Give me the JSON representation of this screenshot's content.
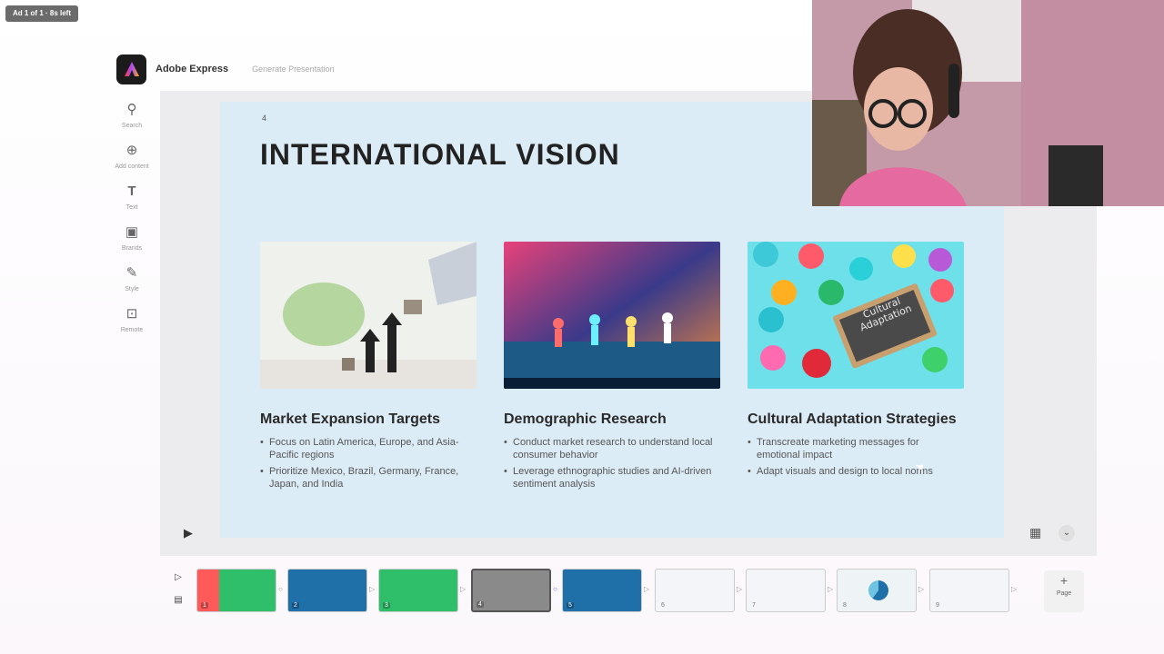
{
  "ad": {
    "label": "Ad 1 of 1 · 8s left"
  },
  "app": {
    "name": "Adobe Express",
    "breadcrumb": "Generate Presentation"
  },
  "leftnav": [
    {
      "label": "Search",
      "icon": "search-icon"
    },
    {
      "label": "Add content",
      "icon": "plus-circle-icon"
    },
    {
      "label": "Text",
      "icon": "text-icon"
    },
    {
      "label": "Brands",
      "icon": "brand-icon"
    },
    {
      "label": "Style",
      "icon": "style-icon"
    },
    {
      "label": "Remote",
      "icon": "remote-icon"
    }
  ],
  "slide": {
    "number": "4",
    "title": "INTERNATIONAL VISION",
    "cards": [
      {
        "title": "Market Expansion Targets",
        "bullets": [
          "Focus on Latin America, Europe, and Asia-Pacific regions",
          "Prioritize Mexico, Brazil, Germany, France, Japan, and India"
        ]
      },
      {
        "title": "Demographic Research",
        "bullets": [
          "Conduct market research to understand local consumer behavior",
          "Leverage ethnographic studies and AI-driven sentiment analysis"
        ]
      },
      {
        "title": "Cultural Adaptation Strategies",
        "bullets": [
          "Transcreate marketing messages for emotional impact",
          "Adapt visuals and design to local norms"
        ]
      }
    ],
    "chalkboard_text": "Cultural Adaptation"
  },
  "filmstrip": {
    "thumbs": [
      {
        "num": "1",
        "style": "green-red"
      },
      {
        "num": "2",
        "style": "blue"
      },
      {
        "num": "3",
        "style": "green"
      },
      {
        "num": "4",
        "style": "gray"
      },
      {
        "num": "5",
        "style": "blue"
      },
      {
        "num": "6",
        "style": "light"
      },
      {
        "num": "7",
        "style": "light"
      },
      {
        "num": "8",
        "style": "light"
      },
      {
        "num": "9",
        "style": "light"
      }
    ],
    "add_page": {
      "label": "Page"
    }
  },
  "colors": {
    "slide_bg": "#dcecf6",
    "accent_green": "#2fbf6a",
    "accent_blue": "#1f6fa8"
  }
}
